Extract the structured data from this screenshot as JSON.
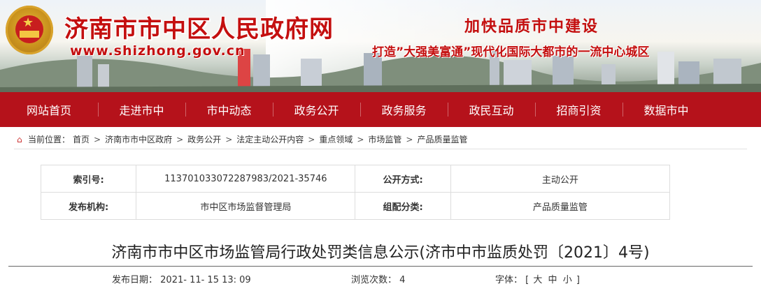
{
  "header": {
    "site_title": "济南市市中区人民政府网",
    "url": "www.shizhong.gov.cn",
    "slogan_main": "加快品质市中建设",
    "slogan_sub": "打造”大强美富通”现代化国际大都市的一流中心城区"
  },
  "nav": [
    {
      "label": "网站首页"
    },
    {
      "label": "走进市中"
    },
    {
      "label": "市中动态"
    },
    {
      "label": "政务公开"
    },
    {
      "label": "政务服务"
    },
    {
      "label": "政民互动"
    },
    {
      "label": "招商引资"
    },
    {
      "label": "数据市中"
    }
  ],
  "breadcrumb": {
    "prefix": "当前位置：",
    "items": [
      "首页",
      "济南市市中区政府",
      "政务公开",
      "法定主动公开内容",
      "重点领域",
      "市场监管",
      "产品质量监管"
    ],
    "separator": ">"
  },
  "meta": {
    "index_label": "索引号:",
    "index_value": "11370103307228798​3/2021-35746",
    "open_label": "公开方式:",
    "open_value": "主动公开",
    "org_label": "发布机构:",
    "org_value": "市中区市场监督管理局",
    "cat_label": "组配分类:",
    "cat_value": "产品质量监管"
  },
  "document": {
    "title": "济南市市中区市场监管局行政处罚类信息公示(济市中市监质处罚〔2021〕4号)",
    "date_label": "发布日期：",
    "date_value": "2021- 11- 15 13: 09",
    "views_label": "浏览次数：",
    "views_value": "4",
    "font_label": "字体：",
    "font_open": "[",
    "font_large": "大",
    "font_medium": "中",
    "font_small": "小",
    "font_close": "]"
  },
  "colors": {
    "brand_red": "#c40f0f",
    "nav_red": "#b5121b"
  }
}
